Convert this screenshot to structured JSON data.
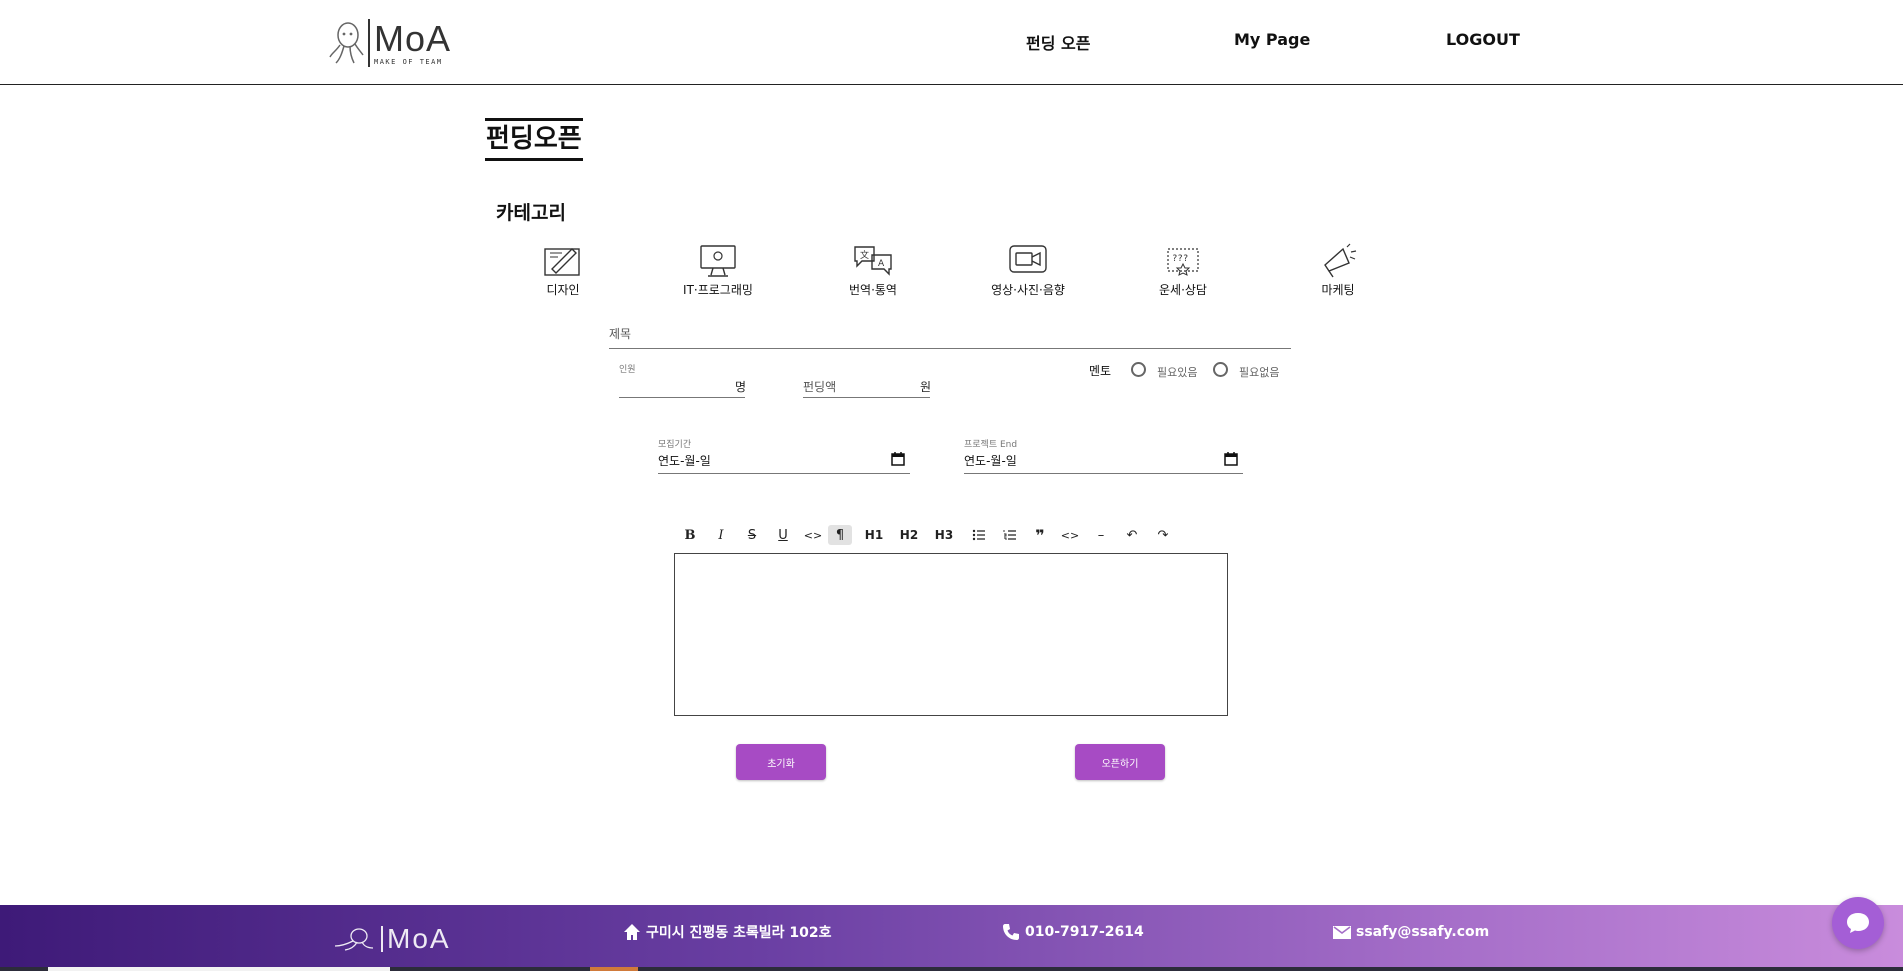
{
  "header": {
    "logo_main": "MoA",
    "logo_sub": "MAKE OF TEAM",
    "nav": [
      {
        "label": "펀딩 오픈"
      },
      {
        "label": "My Page"
      },
      {
        "label": "LOGOUT"
      }
    ]
  },
  "page": {
    "title": "펀딩오픈",
    "category_label": "카테고리"
  },
  "categories": [
    {
      "label": "디자인",
      "icon": "design-pencil-icon"
    },
    {
      "label": "IT·프로그래밍",
      "icon": "monitor-icon"
    },
    {
      "label": "번역·통역",
      "icon": "translate-icon"
    },
    {
      "label": "영상·사진·음향",
      "icon": "video-camera-icon"
    },
    {
      "label": "운세·상담",
      "icon": "fortune-icon"
    },
    {
      "label": "마케팅",
      "icon": "megaphone-icon"
    }
  ],
  "form": {
    "title_placeholder": "제목",
    "members_label": "인원",
    "members_unit": "명",
    "funding_placeholder": "펀딩액",
    "funding_unit": "원",
    "mentor_label": "멘토",
    "mentor_options": [
      "필요있음",
      "필요없음"
    ],
    "recruit_label": "모집기간",
    "recruit_value": "연도-월-일",
    "project_end_label": "프로젝트 End",
    "project_end_value": "연도-월-일"
  },
  "editor": {
    "toolbar": [
      "bold",
      "italic",
      "strike",
      "underline",
      "code",
      "paragraph",
      "H1",
      "H2",
      "H3",
      "bullet-list",
      "ordered-list",
      "blockquote",
      "code-block",
      "horizontal-rule",
      "undo",
      "redo"
    ],
    "h1": "H1",
    "h2": "H2",
    "h3": "H3",
    "content": ""
  },
  "buttons": {
    "reset": "초기화",
    "open": "오픈하기"
  },
  "footer": {
    "logo": "MoA",
    "address": "구미시 진평동 초록빌라 102호",
    "phone": "010-7917-2614",
    "email": "ssafy@ssafy.com"
  },
  "colors": {
    "accent": "#a74bc4",
    "footer_start": "#3e1a78",
    "footer_end": "#c98cdc",
    "chat": "#a45ed6"
  }
}
